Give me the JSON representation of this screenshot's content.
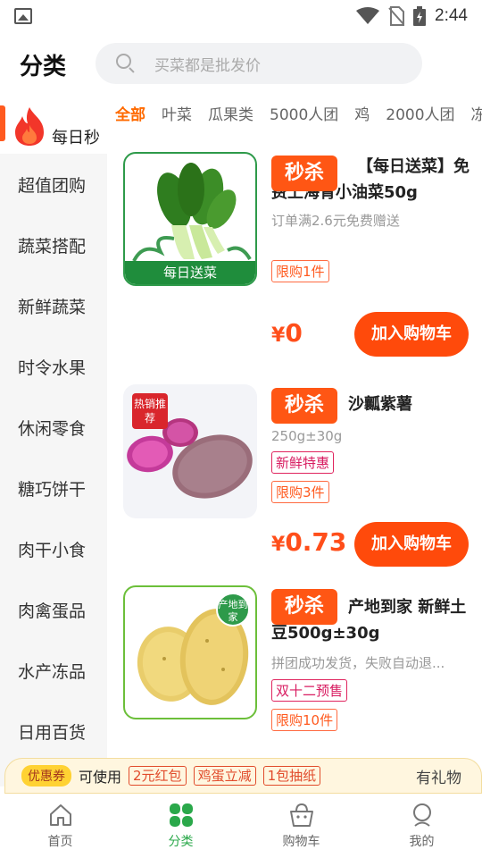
{
  "status_bar": {
    "time": "2:44"
  },
  "header": {
    "title": "分类",
    "search_placeholder": "买菜都是批发价"
  },
  "sidebar": {
    "active_item": "每日秒",
    "items": [
      "超值团购",
      "蔬菜搭配",
      "新鲜蔬菜",
      "时令水果",
      "休闲零食",
      "糖巧饼干",
      "肉干小食",
      "肉禽蛋品",
      "水产冻品",
      "日用百货"
    ]
  },
  "tabs": [
    "全部",
    "叶菜",
    "瓜果类",
    "5000人团",
    "鸡",
    "2000人团",
    "冻"
  ],
  "products": [
    {
      "badge": "秒杀",
      "title": "【每日送菜】免费上海青小油菜50g",
      "subtitle": "订单满2.6元免费赠送",
      "image_label": "每日送菜",
      "tag1": "限购1件",
      "price_symbol": "¥",
      "price": "0",
      "cart_label": "加入购物车"
    },
    {
      "badge": "秒杀",
      "title": "沙瓤紫薯",
      "subtitle": "250g±30g",
      "image_badge": "热销推荐",
      "tag1": "新鲜特惠",
      "tag2": "限购3件",
      "price_symbol": "¥",
      "price": "0.73",
      "cart_label": "加入购物车"
    },
    {
      "badge": "秒杀",
      "title": "产地到家 新鲜土豆500g±30g",
      "subtitle": "拼团成功发货，失败自动退...",
      "image_badge": "产地到家",
      "tag1": "双十二预售",
      "tag2": "限购10件"
    }
  ],
  "coupon_bar": {
    "badge": "优惠券",
    "usable": "可使用",
    "chips": [
      "2元红包",
      "鸡蛋立减",
      "1包抽纸"
    ],
    "gift": "有礼物"
  },
  "bottom_nav": [
    "首页",
    "分类",
    "购物车",
    "我的"
  ],
  "colors": {
    "accent": "#ff5614",
    "nav_active": "#2aa84a"
  }
}
